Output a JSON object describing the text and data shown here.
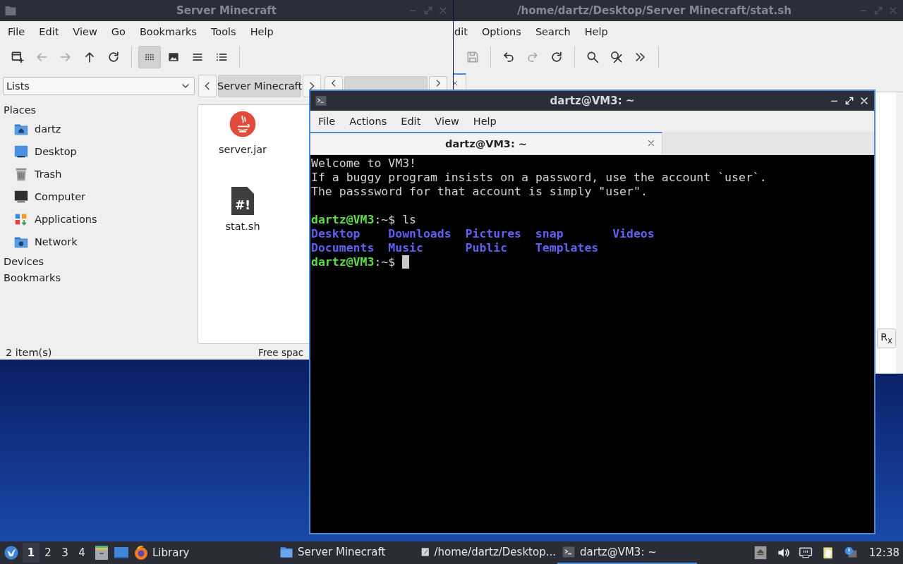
{
  "file_manager": {
    "title": "Server Minecraft",
    "active": false,
    "menu": [
      "File",
      "Edit",
      "View",
      "Go",
      "Bookmarks",
      "Tools",
      "Help"
    ],
    "toolbar": [
      {
        "kind": "new-window",
        "disabled": false
      },
      {
        "kind": "back",
        "disabled": true
      },
      {
        "kind": "forward",
        "disabled": true
      },
      {
        "kind": "up",
        "disabled": false
      },
      {
        "kind": "reload",
        "disabled": false
      }
    ],
    "view_modes": [
      {
        "kind": "icons",
        "selected": true
      },
      {
        "kind": "thumbnails",
        "selected": false
      },
      {
        "kind": "compact",
        "selected": false
      },
      {
        "kind": "details",
        "selected": false
      }
    ],
    "side_pane_mode": "Lists",
    "path_bars": [
      {
        "label": "Server Minecraft"
      }
    ],
    "sections": [
      {
        "title": "Places",
        "items": [
          {
            "label": "dartz",
            "kind": "home"
          },
          {
            "label": "Desktop",
            "kind": "desktop"
          },
          {
            "label": "Trash",
            "kind": "trash"
          },
          {
            "label": "Computer",
            "kind": "computer"
          },
          {
            "label": "Applications",
            "kind": "applications"
          },
          {
            "label": "Network",
            "kind": "network"
          }
        ]
      },
      {
        "title": "Devices"
      },
      {
        "title": "Bookmarks"
      }
    ],
    "files": [
      {
        "name": "server.jar",
        "kind": "java"
      },
      {
        "name": "stat.sh",
        "kind": "script",
        "badge": "#!"
      }
    ],
    "status": {
      "item_count": "2 item(s)",
      "free_space": "Free spac"
    }
  },
  "text_editor": {
    "title": "/home/dartz/Desktop/Server Minecraft/stat.sh",
    "active": false,
    "menu": [
      "dit",
      "Options",
      "Search",
      "Help"
    ],
    "toolbar_groups": [
      [
        {
          "kind": "save",
          "disabled": true
        }
      ],
      [
        {
          "kind": "undo",
          "disabled": false
        },
        {
          "kind": "redo",
          "disabled": true
        },
        {
          "kind": "reload",
          "disabled": false
        }
      ],
      [
        {
          "kind": "find",
          "disabled": false
        },
        {
          "kind": "replace",
          "disabled": false
        },
        {
          "kind": "more",
          "disabled": false
        }
      ]
    ],
    "side_button": "R$_{x}$"
  },
  "terminal": {
    "title": "dartz@VM3: ~",
    "active": true,
    "menu": [
      "File",
      "Actions",
      "Edit",
      "View",
      "Help"
    ],
    "tabs": [
      {
        "label": "dartz@VM3: ~",
        "selected": true
      }
    ],
    "lines": [
      {
        "kind": "text",
        "text": "Welcome to VM3!"
      },
      {
        "kind": "text",
        "text": "If a buggy program insists on a password, use the account `user`."
      },
      {
        "kind": "text",
        "text": "The passsword for that account is simply \"user\"."
      },
      {
        "kind": "blank"
      },
      {
        "kind": "prompt",
        "user": "dartz@VM3",
        "rest": ":~$ ls"
      },
      {
        "kind": "listing",
        "items": [
          "Desktop",
          "Downloads",
          "Pictures",
          "snap",
          "Videos"
        ]
      },
      {
        "kind": "listing",
        "items": [
          "Documents",
          "Music",
          "Public",
          "Templates"
        ]
      },
      {
        "kind": "prompt",
        "user": "dartz@VM3",
        "rest": ":~$",
        "cursor": true
      }
    ]
  },
  "taskbar": {
    "workspaces": [
      {
        "label": "1",
        "selected": true
      },
      {
        "label": "2",
        "selected": false
      },
      {
        "label": "3",
        "selected": false
      },
      {
        "label": "4",
        "selected": false
      }
    ],
    "launchers": [
      {
        "kind": "file-cabinet"
      },
      {
        "kind": "window"
      },
      {
        "kind": "browser",
        "label": "Library"
      }
    ],
    "tasks": [
      {
        "kind": "folder",
        "label": "Server Minecraft",
        "selected": false
      },
      {
        "kind": "editor",
        "label": "/home/dartz/Desktop...",
        "selected": false
      },
      {
        "kind": "terminal",
        "label": "dartz@VM3: ~",
        "selected": true
      }
    ],
    "tray": [
      {
        "kind": "eject"
      },
      {
        "kind": "volume"
      },
      {
        "kind": "network"
      },
      {
        "kind": "clipboard"
      },
      {
        "kind": "notification"
      }
    ],
    "clock": "12:38"
  }
}
